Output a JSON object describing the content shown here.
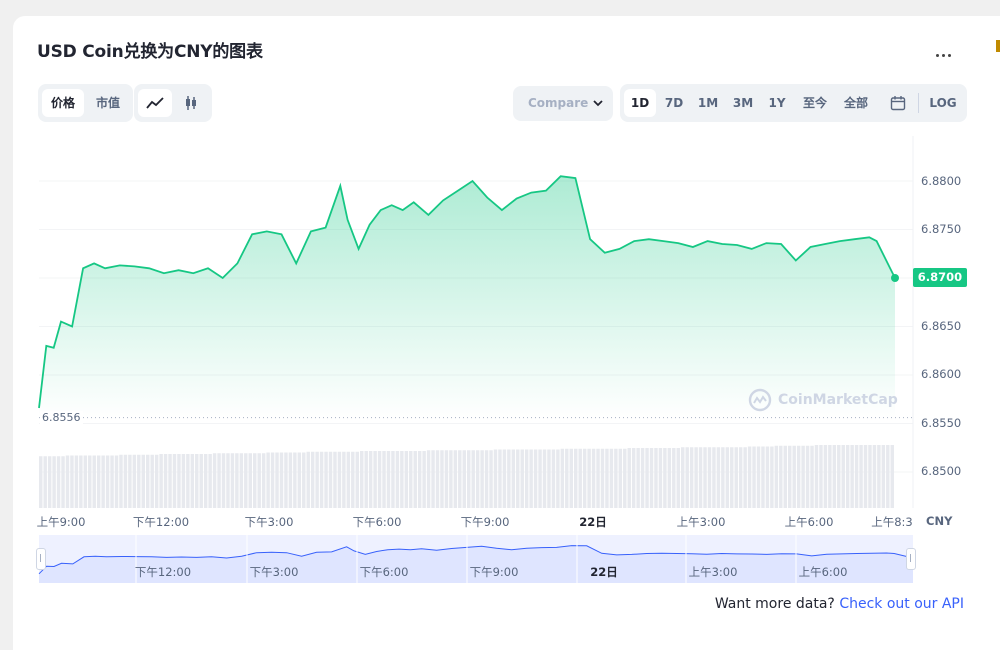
{
  "title": "USD Coin兑换为CNY的图表",
  "toolbar": {
    "tab_price": "价格",
    "tab_marketcap": "市值",
    "line_chart_icon": "line-chart-icon",
    "candle_chart_icon": "candlestick-icon",
    "compare_label": "Compare  ",
    "compare_chevron": "chevron-down-icon",
    "ranges": [
      "1D",
      "7D",
      "1M",
      "3M",
      "1Y",
      "至今",
      "全部"
    ],
    "active_range": "1D",
    "calendar_icon": "calendar-icon",
    "log_label": "LOG",
    "more_icon": "more-horizontal-icon"
  },
  "last_price_label": "6.8700",
  "baseline_label": "6.8556",
  "currency_label": "CNY",
  "watermark": "CoinMarketCap",
  "footer": {
    "text": "Want more data?",
    "link": "Check out our API"
  },
  "colors": {
    "line": "#16c784",
    "nav_fill": "#dfe5ff",
    "nav_line": "#3861fb",
    "link": "#3861fb"
  },
  "chart_data": {
    "type": "area",
    "title": "USD Coin兑换为CNY的图表",
    "xlabel": "",
    "ylabel": "",
    "ylim": [
      6.845,
      6.885
    ],
    "yticks": [
      "6.8800",
      "6.8750",
      "6.8700",
      "6.8650",
      "6.8600",
      "6.8550",
      "6.8500"
    ],
    "xticks": [
      "上午9:00",
      "下午12:00",
      "下午3:00",
      "下午6:00",
      "下午9:00",
      "22日",
      "上午3:00",
      "上午6:00",
      "上午8:3"
    ],
    "x_hours": [
      9.0,
      9.2,
      9.4,
      9.6,
      9.9,
      10.2,
      10.5,
      10.8,
      11.2,
      11.6,
      12.0,
      12.4,
      12.8,
      13.2,
      13.6,
      14.0,
      14.4,
      14.8,
      15.2,
      15.6,
      16.0,
      16.4,
      16.8,
      17.2,
      17.4,
      17.7,
      18.0,
      18.3,
      18.6,
      18.9,
      19.2,
      19.6,
      20.0,
      20.4,
      20.8,
      21.2,
      21.6,
      22.0,
      22.4,
      22.8,
      23.2,
      23.6,
      24.0,
      24.4,
      24.8,
      25.2,
      25.6,
      26.0,
      26.4,
      26.8,
      27.2,
      27.6,
      28.0,
      28.4,
      28.8,
      29.2,
      29.6,
      30.0,
      30.4,
      30.8,
      31.2,
      31.6,
      31.8,
      32.3
    ],
    "values": [
      6.8566,
      6.863,
      6.8628,
      6.8655,
      6.865,
      6.871,
      6.8715,
      6.871,
      6.8713,
      6.8712,
      6.871,
      6.8705,
      6.8708,
      6.8705,
      6.871,
      6.87,
      6.8715,
      6.8745,
      6.8748,
      6.8745,
      6.8715,
      6.8748,
      6.8752,
      6.8795,
      6.876,
      6.873,
      6.8755,
      6.877,
      6.8775,
      6.877,
      6.8778,
      6.8765,
      6.878,
      6.879,
      6.88,
      6.8783,
      6.877,
      6.8782,
      6.8788,
      6.879,
      6.8805,
      6.8803,
      6.874,
      6.8726,
      6.873,
      6.8738,
      6.874,
      6.8738,
      6.8736,
      6.8732,
      6.8738,
      6.8735,
      6.8734,
      6.873,
      6.8736,
      6.8735,
      6.8718,
      6.8732,
      6.8735,
      6.8738,
      6.874,
      6.8742,
      6.8738,
      6.87
    ],
    "volume": [
      61,
      61,
      60,
      60,
      60,
      60,
      59,
      59,
      59,
      58,
      58,
      58,
      58,
      57,
      57,
      57,
      57,
      56,
      56,
      56,
      55,
      55,
      55,
      55,
      54,
      54,
      54,
      54,
      54,
      53,
      53,
      53,
      53,
      53,
      52,
      52,
      52,
      52,
      52,
      51,
      51,
      51,
      51,
      51,
      50,
      50,
      50,
      50,
      49,
      49,
      49,
      49,
      49,
      48,
      48,
      47,
      47,
      47,
      46,
      46,
      46,
      46,
      46,
      46
    ],
    "navigator_ticks": [
      "下午12:00",
      "下午3:00",
      "下午6:00",
      "下午9:00",
      "22日",
      "上午3:00",
      "上午6:00"
    ],
    "last_value": 6.87,
    "baseline_value": 6.8556,
    "grid": true,
    "legend": "none"
  }
}
